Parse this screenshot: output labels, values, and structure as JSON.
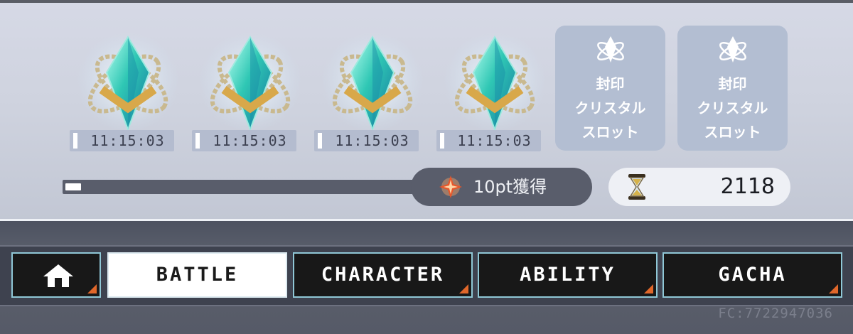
{
  "crystals": [
    {
      "timer": "11:15:03"
    },
    {
      "timer": "11:15:03"
    },
    {
      "timer": "11:15:03"
    },
    {
      "timer": "11:15:03"
    }
  ],
  "sealed_slots": [
    {
      "line1": "封印",
      "line2": "クリスタル",
      "line3": "スロット"
    },
    {
      "line1": "封印",
      "line2": "クリスタル",
      "line3": "スロット"
    }
  ],
  "progress": {
    "value_fraction": 0.04,
    "reward_label": "10pt獲得",
    "reward_icon": "orange-star-gem-icon"
  },
  "currency": {
    "icon": "hourglass-icon",
    "value": "2118"
  },
  "nav": {
    "home_icon": "home-icon",
    "items": [
      "BATTLE",
      "CHARACTER",
      "ABILITY",
      "GACHA"
    ],
    "active": "BATTLE",
    "accent_color": "#e0672a"
  },
  "footer": {
    "fc_code": "FC:7722947036"
  }
}
